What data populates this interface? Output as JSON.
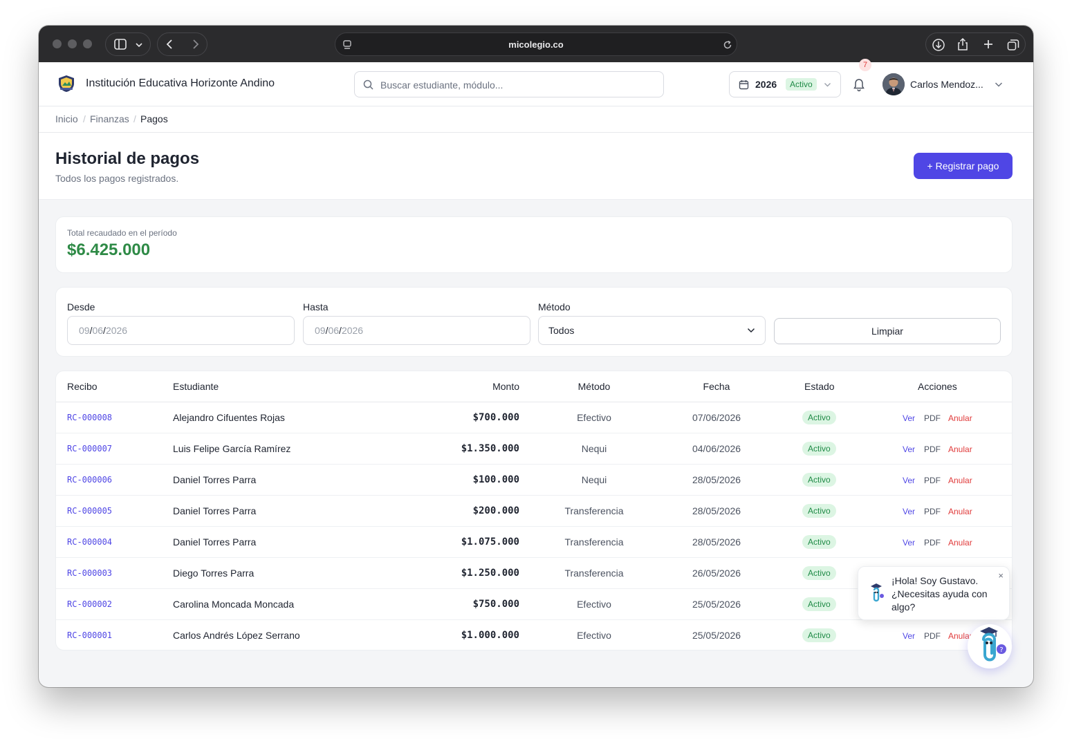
{
  "browser": {
    "url": "micolegio.co"
  },
  "header": {
    "school_name": "Institución Educativa Horizonte Andino",
    "search_placeholder": "Buscar estudiante, módulo...",
    "year": "2026",
    "year_status": "Activo",
    "notification_count": "7",
    "user_name": "Carlos Mendoz..."
  },
  "breadcrumb": [
    "Inicio",
    "Finanzas",
    "Pagos"
  ],
  "page": {
    "title": "Historial de pagos",
    "subtitle": "Todos los pagos registrados.",
    "primary_button": "+ Registrar pago"
  },
  "stats": {
    "label": "Total recaudado en el período",
    "value": "$6.425.000"
  },
  "filters": {
    "from_label": "Desde",
    "from_value": {
      "d": "09",
      "m": "06",
      "y": "2026"
    },
    "to_label": "Hasta",
    "to_value": {
      "d": "09",
      "m": "06",
      "y": "2026"
    },
    "method_label": "Método",
    "method_value": "Todos",
    "clear_button": "Limpiar"
  },
  "table": {
    "columns": [
      "Recibo",
      "Estudiante",
      "Monto",
      "Método",
      "Fecha",
      "Estado",
      "Acciones"
    ],
    "action_labels": {
      "view": "Ver",
      "pdf": "PDF",
      "void": "Anular"
    },
    "rows": [
      {
        "receipt": "RC-000008",
        "student": "Alejandro Cifuentes Rojas",
        "amount": "$700.000",
        "method": "Efectivo",
        "date": "07/06/2026",
        "status": "Activo"
      },
      {
        "receipt": "RC-000007",
        "student": "Luis Felipe García Ramírez",
        "amount": "$1.350.000",
        "method": "Nequi",
        "date": "04/06/2026",
        "status": "Activo"
      },
      {
        "receipt": "RC-000006",
        "student": "Daniel Torres Parra",
        "amount": "$100.000",
        "method": "Nequi",
        "date": "28/05/2026",
        "status": "Activo"
      },
      {
        "receipt": "RC-000005",
        "student": "Daniel Torres Parra",
        "amount": "$200.000",
        "method": "Transferencia",
        "date": "28/05/2026",
        "status": "Activo"
      },
      {
        "receipt": "RC-000004",
        "student": "Daniel Torres Parra",
        "amount": "$1.075.000",
        "method": "Transferencia",
        "date": "28/05/2026",
        "status": "Activo"
      },
      {
        "receipt": "RC-000003",
        "student": "Diego Torres Parra",
        "amount": "$1.250.000",
        "method": "Transferencia",
        "date": "26/05/2026",
        "status": "Activo"
      },
      {
        "receipt": "RC-000002",
        "student": "Carolina Moncada Moncada",
        "amount": "$750.000",
        "method": "Efectivo",
        "date": "25/05/2026",
        "status": "Activo"
      },
      {
        "receipt": "RC-000001",
        "student": "Carlos Andrés López Serrano",
        "amount": "$1.000.000",
        "method": "Efectivo",
        "date": "25/05/2026",
        "status": "Activo"
      }
    ]
  },
  "chat": {
    "message": "¡Hola! Soy Gustavo. ¿Necesitas ayuda con algo?",
    "close": "×"
  },
  "colors": {
    "primary": "#4f46e5",
    "success": "#2e8a46",
    "danger": "#e03a3a"
  }
}
